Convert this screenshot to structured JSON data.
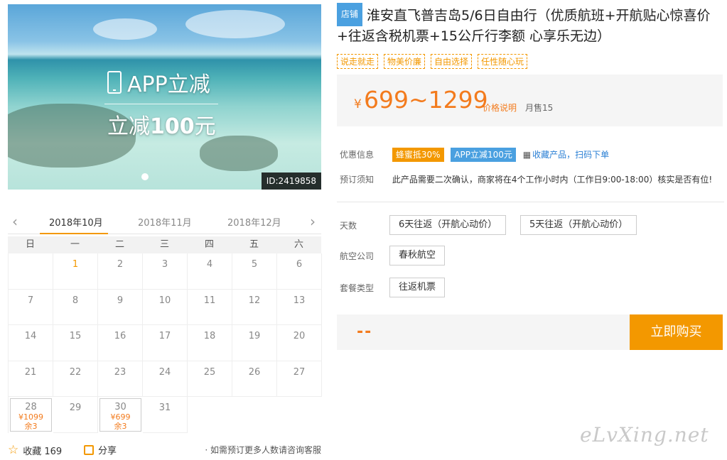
{
  "hero": {
    "promo_line1": "APP立减",
    "promo_line2_prefix": "立减",
    "promo_line2_amount": "100",
    "promo_line2_suffix": "元",
    "id_badge": "ID:2419858"
  },
  "calendar": {
    "months": [
      "2018年10月",
      "2018年11月",
      "2018年12月"
    ],
    "weekdays": [
      "日",
      "一",
      "二",
      "三",
      "四",
      "五",
      "六"
    ],
    "days": [
      {
        "day": "",
        "orange": false
      },
      {
        "day": "1",
        "orange": true
      },
      {
        "day": "2",
        "orange": false
      },
      {
        "day": "3",
        "orange": false
      },
      {
        "day": "4",
        "orange": false
      },
      {
        "day": "5",
        "orange": false
      },
      {
        "day": "6",
        "orange": false
      },
      {
        "day": "7",
        "orange": false
      },
      {
        "day": "8",
        "orange": false
      },
      {
        "day": "9",
        "orange": false
      },
      {
        "day": "10",
        "orange": false
      },
      {
        "day": "11",
        "orange": false
      },
      {
        "day": "12",
        "orange": false
      },
      {
        "day": "13",
        "orange": false
      },
      {
        "day": "14",
        "orange": false
      },
      {
        "day": "15",
        "orange": false
      },
      {
        "day": "16",
        "orange": false
      },
      {
        "day": "17",
        "orange": false
      },
      {
        "day": "18",
        "orange": false
      },
      {
        "day": "19",
        "orange": false
      },
      {
        "day": "20",
        "orange": false
      },
      {
        "day": "21",
        "orange": false
      },
      {
        "day": "22",
        "orange": false
      },
      {
        "day": "23",
        "orange": false
      },
      {
        "day": "24",
        "orange": false
      },
      {
        "day": "25",
        "orange": false
      },
      {
        "day": "26",
        "orange": false
      },
      {
        "day": "27",
        "orange": false
      },
      {
        "day": "28",
        "orange": false,
        "price": "¥1099",
        "left": "余3"
      },
      {
        "day": "29",
        "orange": false
      },
      {
        "day": "30",
        "orange": false,
        "price": "¥699",
        "left": "余3"
      },
      {
        "day": "31",
        "orange": false
      }
    ]
  },
  "actions": {
    "favorite": "收藏 169",
    "share": "分享",
    "consult": "· 如需预订更多人数请咨询客服"
  },
  "product": {
    "store_tag": "店铺",
    "title": "淮安直飞普吉岛5/6日自由行（优质航班+开航贴心惊喜价+往返含税机票+15公斤行李额 心享乐无边）",
    "tags": [
      "说走就走",
      "物美价廉",
      "自由选择",
      "任性随心玩"
    ],
    "currency": "¥",
    "price_range": "699~1299",
    "price_explain": "价格说明",
    "monthly_sales": "月售15"
  },
  "info": {
    "discount_label": "优惠信息",
    "coupon1": "蜂蜜抵30%",
    "coupon2": "APP立减100元",
    "qr_text": "收藏产品，扫码下单",
    "notice_label": "预订须知",
    "notice_text": "此产品需要二次确认，商家将在4个工作小时内（工作日9:00-18:00）核实是否有位!"
  },
  "options": {
    "days_label": "天数",
    "days": [
      "6天往返（开航心动价）",
      "5天往返（开航心动价）"
    ],
    "airline_label": "航空公司",
    "airline": "春秋航空",
    "package_label": "套餐类型",
    "package": "往返机票"
  },
  "buy": {
    "placeholder_price": "--",
    "button": "立即购买"
  },
  "watermark": "eLvXing.net"
}
